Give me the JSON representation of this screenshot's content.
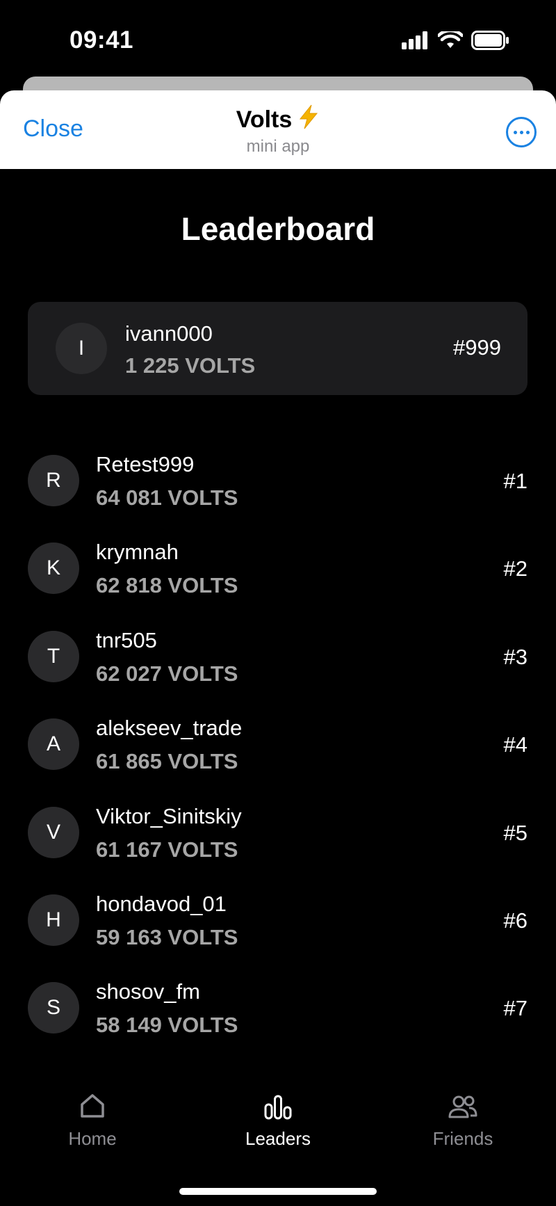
{
  "status_bar": {
    "time": "09:41"
  },
  "header": {
    "close_label": "Close",
    "title": "Volts",
    "title_emoji": "⚡",
    "subtitle": "mini app"
  },
  "page": {
    "title": "Leaderboard"
  },
  "me": {
    "initial": "I",
    "name": "ivann000",
    "score": "1 225 VOLTS",
    "rank": "#999"
  },
  "leaders": [
    {
      "initial": "R",
      "name": "Retest999",
      "score": "64 081 VOLTS",
      "rank": "#1"
    },
    {
      "initial": "K",
      "name": "krymnah",
      "score": "62 818 VOLTS",
      "rank": "#2"
    },
    {
      "initial": "T",
      "name": "tnr505",
      "score": "62 027 VOLTS",
      "rank": "#3"
    },
    {
      "initial": "A",
      "name": "alekseev_trade",
      "score": "61 865 VOLTS",
      "rank": "#4"
    },
    {
      "initial": "V",
      "name": "Viktor_Sinitskiy",
      "score": "61 167 VOLTS",
      "rank": "#5"
    },
    {
      "initial": "H",
      "name": "hondavod_01",
      "score": "59 163 VOLTS",
      "rank": "#6"
    },
    {
      "initial": "S",
      "name": "shosov_fm",
      "score": "58 149 VOLTS",
      "rank": "#7"
    }
  ],
  "nav": {
    "home_label": "Home",
    "leaders_label": "Leaders",
    "friends_label": "Friends",
    "active": "leaders"
  },
  "colors": {
    "accent": "#1a82e2",
    "background": "#000000",
    "card": "#1c1c1e",
    "avatar_bg": "#2a2a2c",
    "muted_text": "#a6a6a6",
    "lightning": "#f5b301"
  }
}
